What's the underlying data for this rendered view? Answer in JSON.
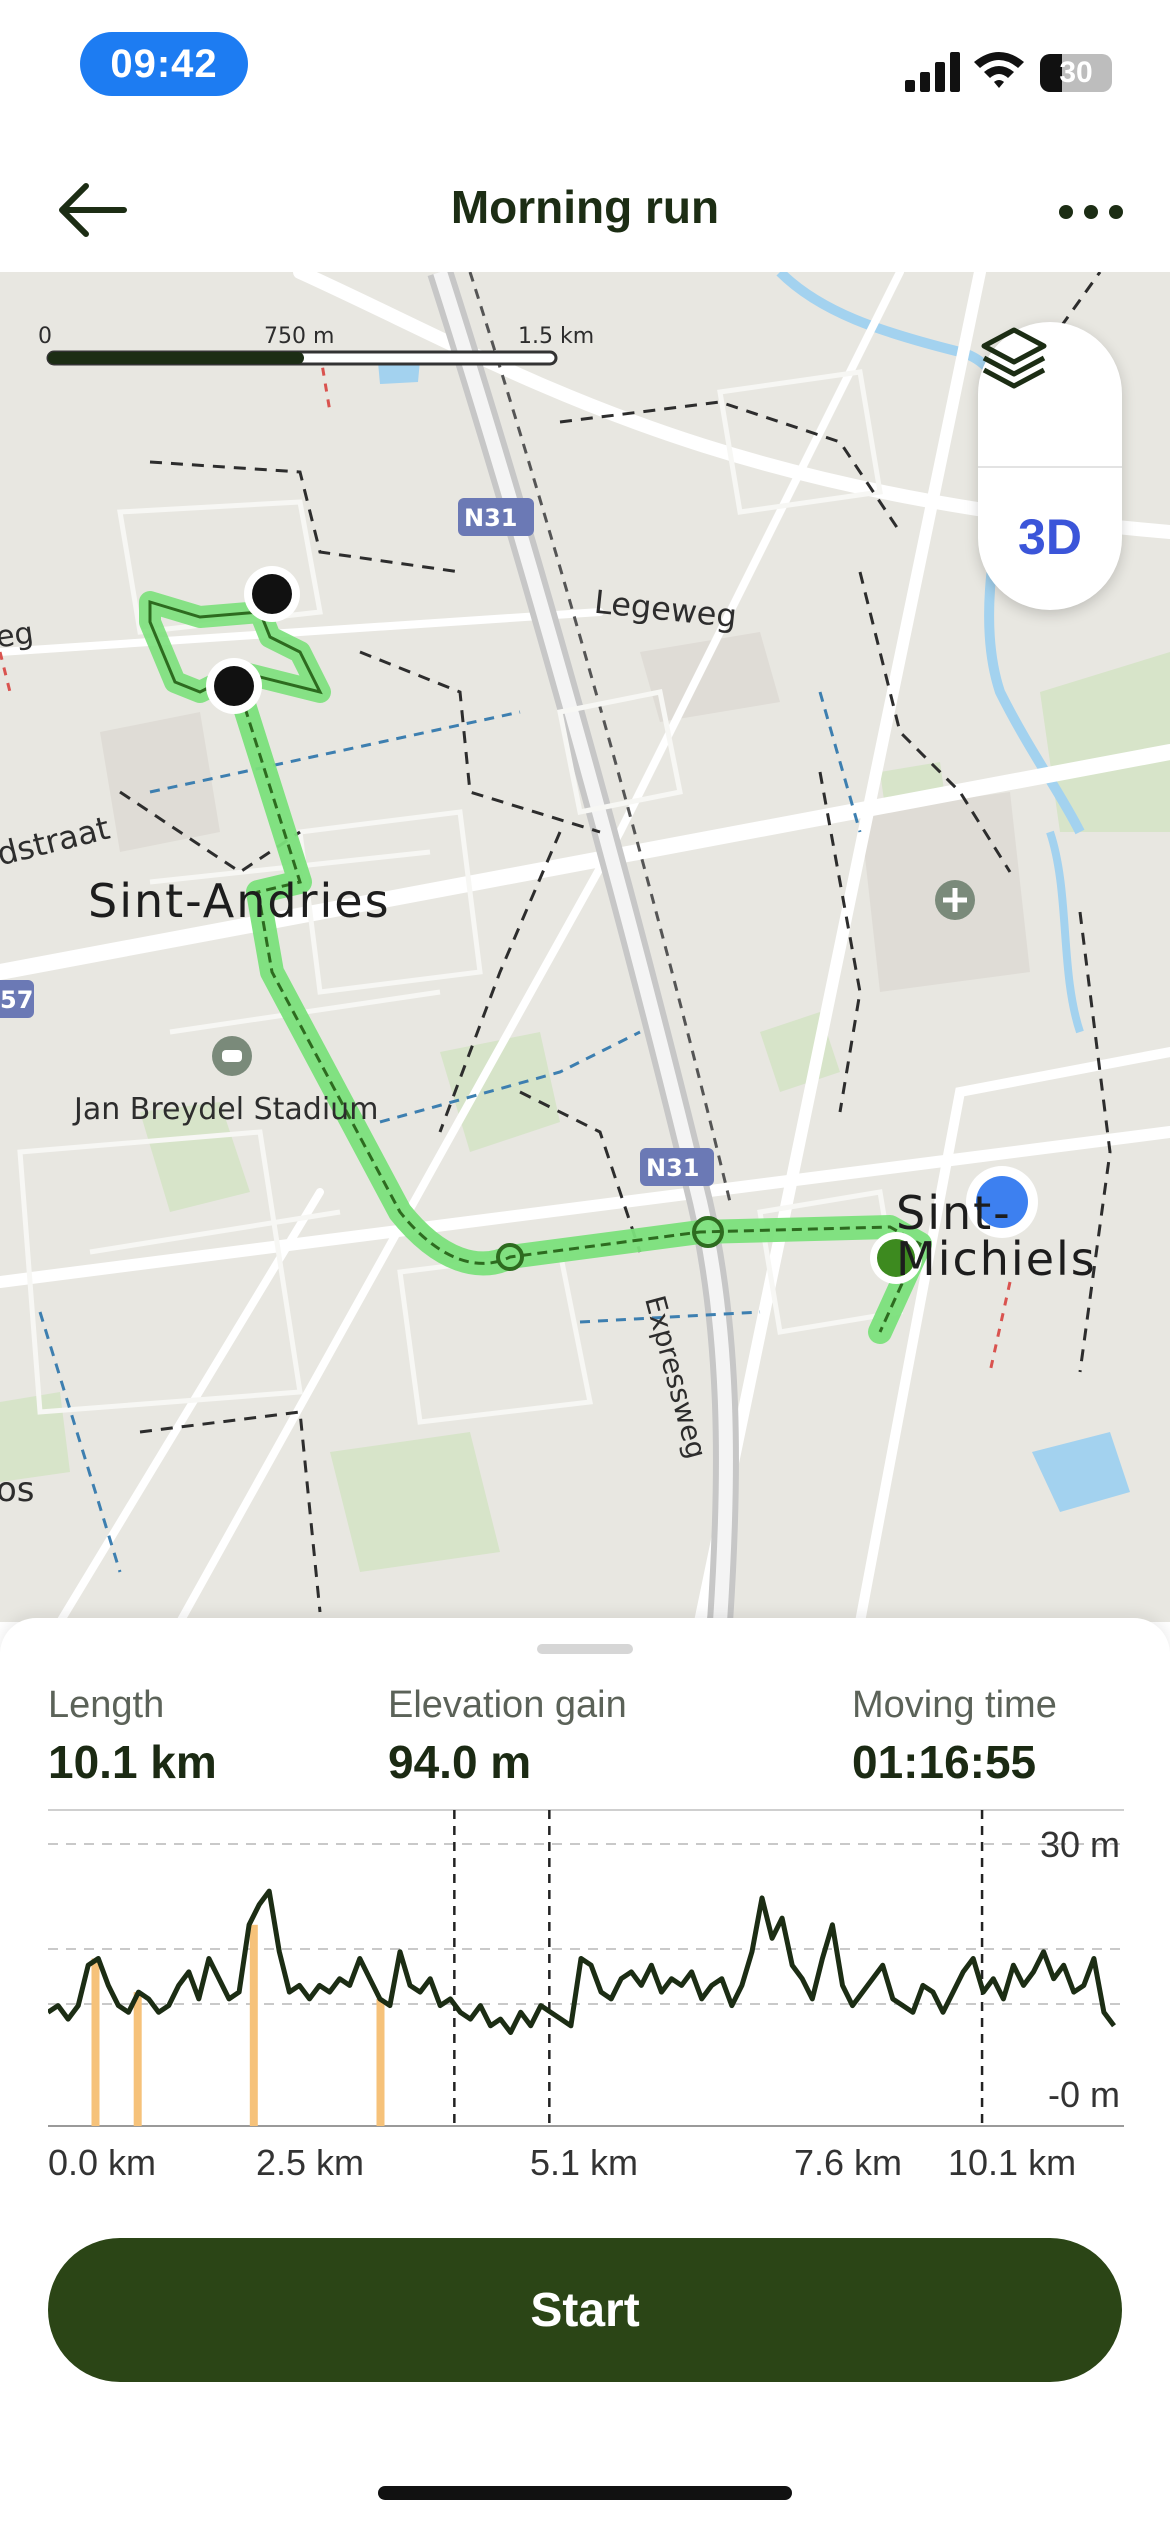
{
  "status_bar": {
    "time": "09:42",
    "battery": "30"
  },
  "header": {
    "title": "Morning run"
  },
  "map": {
    "scale": {
      "ticks": [
        "0",
        "750 m",
        "1.5 km"
      ]
    },
    "roads": [
      "N31",
      "N31",
      "Legeweg",
      "Expressweg"
    ],
    "places": [
      "Sint-Andries",
      "Jan Breydel Stadium",
      "Sint-Michiels"
    ],
    "edge_labels": [
      "eg",
      "dstraat",
      "57",
      "os"
    ],
    "layer_button": {
      "icon": "layers-icon"
    },
    "three_d_label": "3D"
  },
  "stats": [
    {
      "label": "Length",
      "value": "10.1 km"
    },
    {
      "label": "Elevation gain",
      "value": "94.0 m"
    },
    {
      "label": "Moving time",
      "value": "01:16:55"
    }
  ],
  "chart_data": {
    "type": "area",
    "x_unit": "km",
    "x_ticks": [
      "0.0 km",
      "2.5 km",
      "5.1 km",
      "7.6 km",
      "10.1 km"
    ],
    "y_ticks": [
      "30 m",
      "-0 m"
    ],
    "ylim": [
      0,
      30
    ],
    "xlim": [
      0,
      10.1
    ],
    "elevation_m": [
      5,
      6,
      4,
      6,
      12,
      13,
      9,
      6,
      5,
      8,
      7,
      5,
      6,
      9,
      11,
      7,
      13,
      10,
      7,
      8,
      18,
      21,
      23,
      14,
      8,
      9,
      7,
      9,
      8,
      10,
      9,
      13,
      10,
      7,
      6,
      14,
      9,
      8,
      10,
      6,
      7,
      5,
      4,
      6,
      3,
      4,
      2,
      5,
      3,
      6,
      5,
      4,
      3,
      13,
      12,
      8,
      7,
      10,
      11,
      9,
      12,
      8,
      10,
      9,
      11,
      7,
      9,
      10,
      6,
      9,
      14,
      22,
      16,
      19,
      12,
      10,
      7,
      13,
      18,
      9,
      6,
      8,
      10,
      12,
      7,
      6,
      5,
      9,
      8,
      5,
      8,
      11,
      13,
      8,
      10,
      7,
      12,
      9,
      11,
      14,
      10,
      12,
      8,
      9,
      13,
      5,
      3
    ],
    "highlight_x_km": [
      0.45,
      0.85,
      1.95,
      3.15
    ],
    "dashed_markers_x_km": [
      3.85,
      4.75,
      8.85
    ]
  },
  "start_button": {
    "label": "Start"
  }
}
